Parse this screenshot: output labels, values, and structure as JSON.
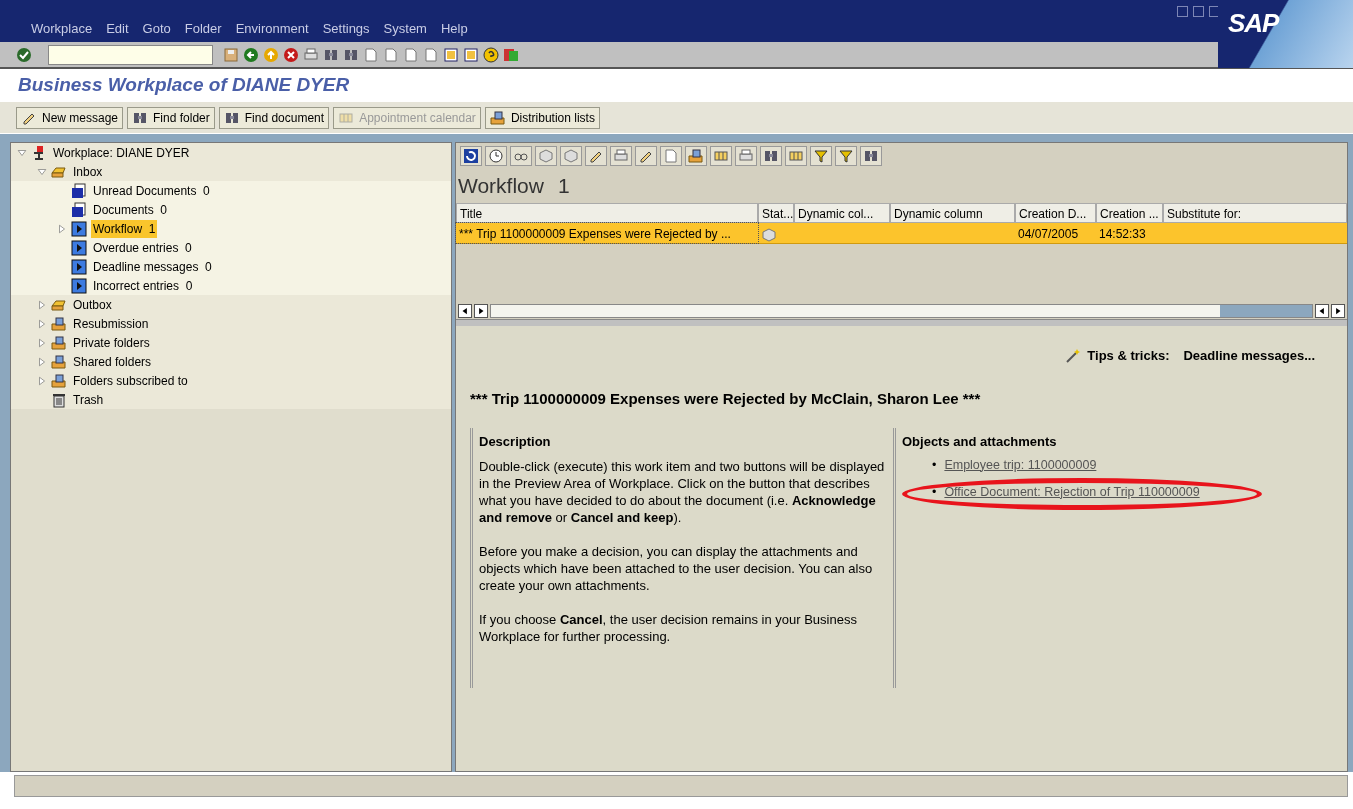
{
  "window": {
    "logo": "SAP"
  },
  "menu": [
    {
      "label": "Workplace"
    },
    {
      "label": "Edit"
    },
    {
      "label": "Goto"
    },
    {
      "label": "Folder"
    },
    {
      "label": "Environment"
    },
    {
      "label": "Settings"
    },
    {
      "label": "System"
    },
    {
      "label": "Help"
    }
  ],
  "page_title": "Business Workplace of DIANE DYER",
  "app_buttons": [
    {
      "label": "New message",
      "disabled": false
    },
    {
      "label": "Find folder",
      "disabled": false
    },
    {
      "label": "Find document",
      "disabled": false
    },
    {
      "label": "Appointment calendar",
      "disabled": true
    },
    {
      "label": "Distribution lists",
      "disabled": false
    }
  ],
  "tree": [
    {
      "label": "Workplace: DIANE DYER",
      "kind": "root",
      "expanded": true,
      "selected": false,
      "children": [
        {
          "label": "Inbox",
          "kind": "tray",
          "expanded": true,
          "selected": false,
          "children": [
            {
              "label": "Unread Documents",
              "count": "0",
              "kind": "document",
              "selected": false
            },
            {
              "label": "Documents",
              "count": "0",
              "kind": "document",
              "selected": false
            },
            {
              "label": "Workflow",
              "count": "1",
              "kind": "workflow",
              "expanded": false,
              "selected": true
            },
            {
              "label": "Overdue entries",
              "count": "0",
              "kind": "workflow",
              "selected": false
            },
            {
              "label": "Deadline messages",
              "count": "0",
              "kind": "workflow",
              "selected": false
            },
            {
              "label": "Incorrect entries",
              "count": "0",
              "kind": "workflow",
              "selected": false
            }
          ]
        },
        {
          "label": "Outbox",
          "kind": "tray",
          "expanded": false,
          "selected": false
        },
        {
          "label": "Resubmission",
          "kind": "folder",
          "expanded": false,
          "selected": false
        },
        {
          "label": "Private folders",
          "kind": "folder",
          "expanded": false,
          "selected": false
        },
        {
          "label": "Shared folders",
          "kind": "folder",
          "expanded": false,
          "selected": false
        },
        {
          "label": "Folders subscribed to",
          "kind": "folder",
          "expanded": false,
          "selected": false
        },
        {
          "label": "Trash",
          "kind": "trash",
          "selected": false
        }
      ]
    }
  ],
  "list": {
    "title": "Workflow",
    "count": "1",
    "columns": [
      "Title",
      "Stat...",
      "Dynamic col...",
      "Dynamic column",
      "Creation D...",
      "Creation ...",
      "Substitute for:"
    ],
    "rows": [
      {
        "selected": true,
        "cells": [
          "*** Trip 1100000009 Expenses were Rejected by ...",
          "",
          "",
          "",
          "04/07/2005",
          "14:52:33",
          ""
        ]
      }
    ]
  },
  "preview": {
    "tips_label": "Tips & tricks:",
    "tips_value": "Deadline messages...",
    "heading": "*** Trip 1100000009 Expenses were Rejected by McClain, Sharon Lee ***",
    "description": {
      "title": "Description",
      "paragraphs": [
        "Double-click (execute) this work item and two buttons will be displayed in the Preview Area of Workplace. Click on the button that describes what you have decided to do about the document (i.e. **Acknowledge and remove** or **Cancel and keep**).",
        "Before you make a decision, you can display the attachments and objects which have been attached to the user decision. You can also create your own attachments.",
        "If you choose **Cancel**, the user decision remains in your Business Workplace for further processing."
      ]
    },
    "objects": {
      "title": "Objects and attachments",
      "links": [
        {
          "bullet": "•",
          "label": "Employee trip: 1100000009",
          "circled": false
        },
        {
          "bullet": "•",
          "label": "Office Document: Rejection of Trip 110000009",
          "circled": true
        }
      ]
    }
  }
}
